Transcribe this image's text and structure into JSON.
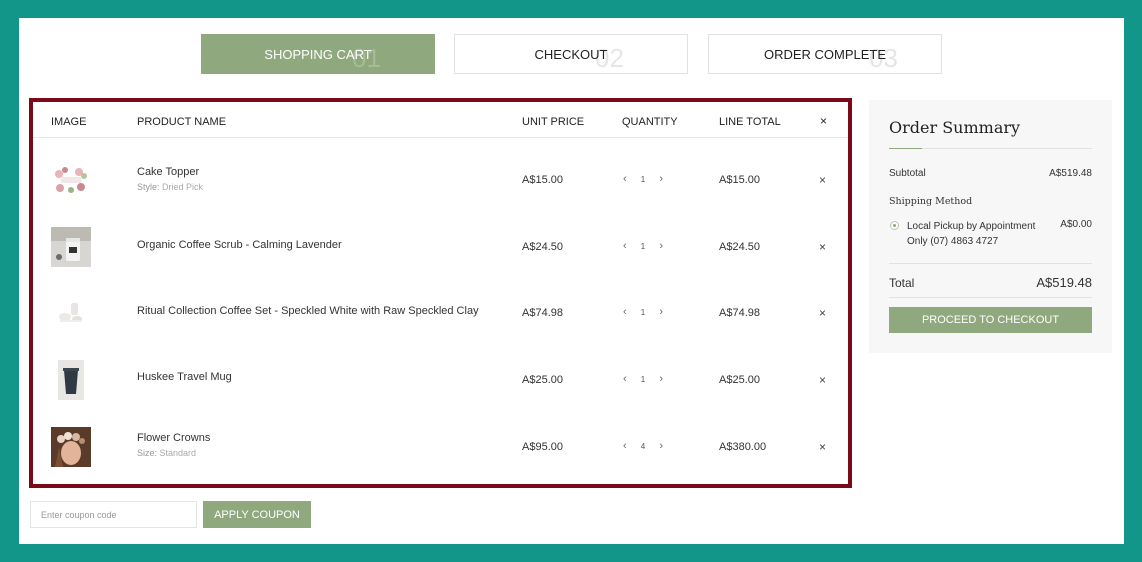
{
  "steps": [
    {
      "label": "SHOPPING CART",
      "num": "01"
    },
    {
      "label": "CHECKOUT",
      "num": "02"
    },
    {
      "label": "ORDER COMPLETE",
      "num": "03"
    }
  ],
  "table": {
    "headers": {
      "image": "IMAGE",
      "product": "PRODUCT NAME",
      "unit_price": "UNIT PRICE",
      "quantity": "QUANTITY",
      "line_total": "LINE TOTAL",
      "remove": "×"
    },
    "rows": [
      {
        "name": "Cake Topper",
        "meta_label": "Style:",
        "meta_value": "Dried Pick",
        "unit_price": "A$15.00",
        "qty": "1",
        "line_total": "A$15.00"
      },
      {
        "name": "Organic Coffee Scrub - Calming Lavender",
        "meta_label": "",
        "meta_value": "",
        "unit_price": "A$24.50",
        "qty": "1",
        "line_total": "A$24.50"
      },
      {
        "name": "Ritual Collection Coffee Set - Speckled White with Raw Speckled Clay",
        "meta_label": "",
        "meta_value": "",
        "unit_price": "A$74.98",
        "qty": "1",
        "line_total": "A$74.98"
      },
      {
        "name": "Huskee Travel Mug",
        "meta_label": "",
        "meta_value": "",
        "unit_price": "A$25.00",
        "qty": "1",
        "line_total": "A$25.00"
      },
      {
        "name": "Flower Crowns",
        "meta_label": "Size:",
        "meta_value": "Standard",
        "unit_price": "A$95.00",
        "qty": "4",
        "line_total": "A$380.00"
      }
    ],
    "qty_minus": "‹",
    "qty_plus": "›",
    "remove_symbol": "×"
  },
  "coupon": {
    "placeholder": "Enter coupon code",
    "button": "APPLY COUPON"
  },
  "summary": {
    "title": "Order Summary",
    "subtotal_label": "Subtotal",
    "subtotal_value": "A$519.48",
    "shipping_label": "Shipping Method",
    "shipping_option_line1": "Local Pickup by Appointment",
    "shipping_option_line2": "Only (07) 4863 4727",
    "shipping_value": "A$0.00",
    "total_label": "Total",
    "total_value": "A$519.48",
    "proceed": "PROCEED TO CHECKOUT"
  },
  "colors": {
    "frame": "#13968a",
    "accent": "#8fa87d",
    "highlight_border": "#7a0a1a"
  }
}
